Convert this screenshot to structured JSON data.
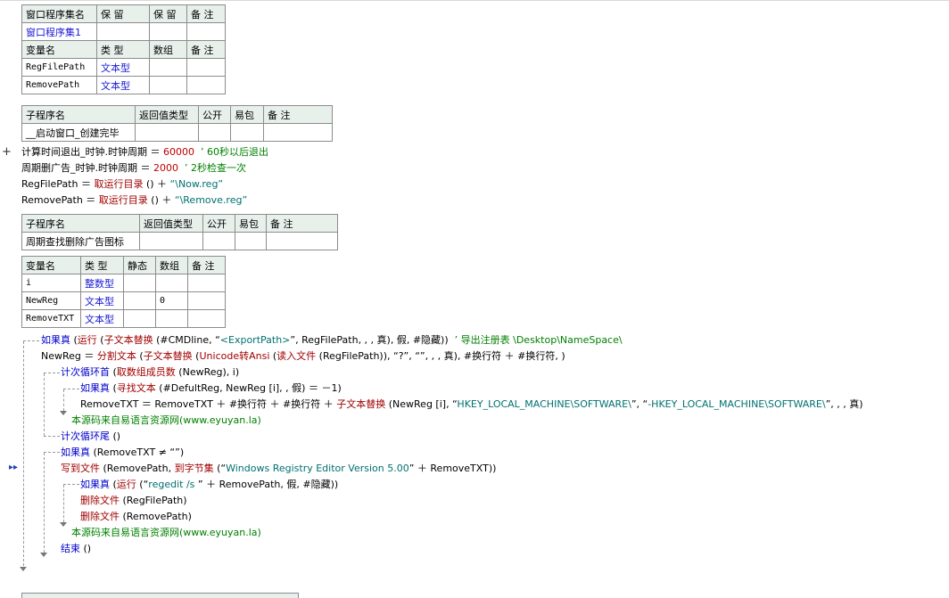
{
  "win_table": {
    "header": [
      "窗口程序集名",
      "保 留",
      "保 留",
      "备 注"
    ],
    "name": "窗口程序集1",
    "var_header": [
      "变量名",
      "类 型",
      "数组",
      "备 注"
    ],
    "vars": [
      {
        "name": "RegFilePath",
        "type": "文本型"
      },
      {
        "name": "RemovePath",
        "type": "文本型"
      }
    ]
  },
  "sub1": {
    "header": [
      "子程序名",
      "返回值类型",
      "公开",
      "易包",
      "备 注"
    ],
    "name": "__启动窗口_创建完毕"
  },
  "sub1_code": [
    [
      [
        "plain",
        "计算时间退出_时钟.时钟周期 ＝ "
      ],
      [
        "num",
        "60000"
      ],
      [
        "cmt",
        "  ’ 60秒以后退出"
      ]
    ],
    [
      [
        "plain",
        "周期删广告_时钟.时钟周期 ＝ "
      ],
      [
        "num",
        "2000"
      ],
      [
        "cmt",
        "  ’ 2秒检查一次"
      ]
    ],
    [
      [
        "plain",
        "RegFilePath ＝ "
      ],
      [
        "fn",
        "取运行目录"
      ],
      [
        "plain",
        " () ＋ "
      ],
      [
        "str",
        "“\\Now.reg”"
      ]
    ],
    [
      [
        "plain",
        "RemovePath ＝ "
      ],
      [
        "fn",
        "取运行目录"
      ],
      [
        "plain",
        " () ＋ "
      ],
      [
        "str",
        "“\\Remove.reg”"
      ]
    ]
  ],
  "sub2": {
    "header": [
      "子程序名",
      "返回值类型",
      "公开",
      "易包",
      "备 注"
    ],
    "name": "周期查找删除广告图标",
    "var_header": [
      "变量名",
      "类 型",
      "静态",
      "数组",
      "备 注"
    ],
    "vars": [
      {
        "name": "i",
        "type": "整数型",
        "array": ""
      },
      {
        "name": "NewReg",
        "type": "文本型",
        "array": "0"
      },
      {
        "name": "RemoveTXT",
        "type": "文本型",
        "array": ""
      }
    ]
  },
  "sub2_code": [
    [
      [
        "kw",
        "如果真"
      ],
      [
        "plain",
        " ("
      ],
      [
        "fn",
        "运行"
      ],
      [
        "plain",
        " ("
      ],
      [
        "fn",
        "子文本替换"
      ],
      [
        "plain",
        " (#CMDline, “"
      ],
      [
        "str",
        "<ExportPath>"
      ],
      [
        "plain",
        "”, RegFilePath, , , 真), 假, #隐藏))"
      ],
      [
        "cmt",
        "  ’ 导出注册表 \\Desktop\\NameSpace\\"
      ]
    ],
    [
      [
        "plain",
        "NewReg ＝ "
      ],
      [
        "fn",
        "分割文本"
      ],
      [
        "plain",
        " ("
      ],
      [
        "fn",
        "子文本替换"
      ],
      [
        "plain",
        " ("
      ],
      [
        "fn",
        "Unicode转Ansi"
      ],
      [
        "plain",
        " ("
      ],
      [
        "fn",
        "读入文件"
      ],
      [
        "plain",
        " (RegFilePath)), “?”, “”, , , 真), #换行符 ＋ #换行符, )"
      ]
    ],
    [
      [
        "kw",
        "计次循环首"
      ],
      [
        "plain",
        " ("
      ],
      [
        "fn",
        "取数组成员数"
      ],
      [
        "plain",
        " (NewReg), i)"
      ]
    ],
    [
      [
        "kw",
        "如果真"
      ],
      [
        "plain",
        " ("
      ],
      [
        "fn",
        "寻找文本"
      ],
      [
        "plain",
        " (#DefultReg, NewReg [i], , 假) ＝ －1)"
      ]
    ],
    [
      [
        "plain",
        "RemoveTXT ＝ RemoveTXT ＋ #换行符 ＋ #换行符 ＋ "
      ],
      [
        "fn",
        "子文本替换"
      ],
      [
        "plain",
        " (NewReg [i], “"
      ],
      [
        "str",
        "HKEY_LOCAL_MACHINE\\SOFTWARE\\"
      ],
      [
        "plain",
        "”, “"
      ],
      [
        "str",
        "-HKEY_LOCAL_MACHINE\\SOFTWARE\\"
      ],
      [
        "plain",
        "”, , , 真)"
      ]
    ],
    [
      [
        "cmt",
        "本源码来自易语言资源网(www.eyuyan.la)"
      ]
    ],
    [
      [
        "kw",
        "计次循环尾"
      ],
      [
        "plain",
        " ()"
      ]
    ],
    [
      [
        "kw",
        "如果真"
      ],
      [
        "plain",
        " (RemoveTXT ≠ “”)"
      ]
    ],
    [
      [
        "fn",
        "写到文件"
      ],
      [
        "plain",
        " (RemovePath, "
      ],
      [
        "fn",
        "到字节集"
      ],
      [
        "plain",
        " (“"
      ],
      [
        "str",
        "Windows Registry Editor Version 5.00"
      ],
      [
        "plain",
        "” ＋ RemoveTXT))"
      ]
    ],
    [
      [
        "kw",
        "如果真"
      ],
      [
        "plain",
        " ("
      ],
      [
        "fn",
        "运行"
      ],
      [
        "plain",
        " (“"
      ],
      [
        "str",
        "regedit /s "
      ],
      [
        "plain",
        "” ＋ RemovePath, 假, #隐藏))"
      ]
    ],
    [
      [
        "fn",
        "删除文件"
      ],
      [
        "plain",
        " (RegFilePath)"
      ]
    ],
    [
      [
        "fn",
        "删除文件"
      ],
      [
        "plain",
        " (RemovePath)"
      ]
    ],
    [
      [
        "cmt",
        "本源码来自易语言资源网(www.eyuyan.la)"
      ]
    ],
    [
      [
        "kw",
        "结束"
      ],
      [
        "plain",
        " ()"
      ]
    ]
  ]
}
